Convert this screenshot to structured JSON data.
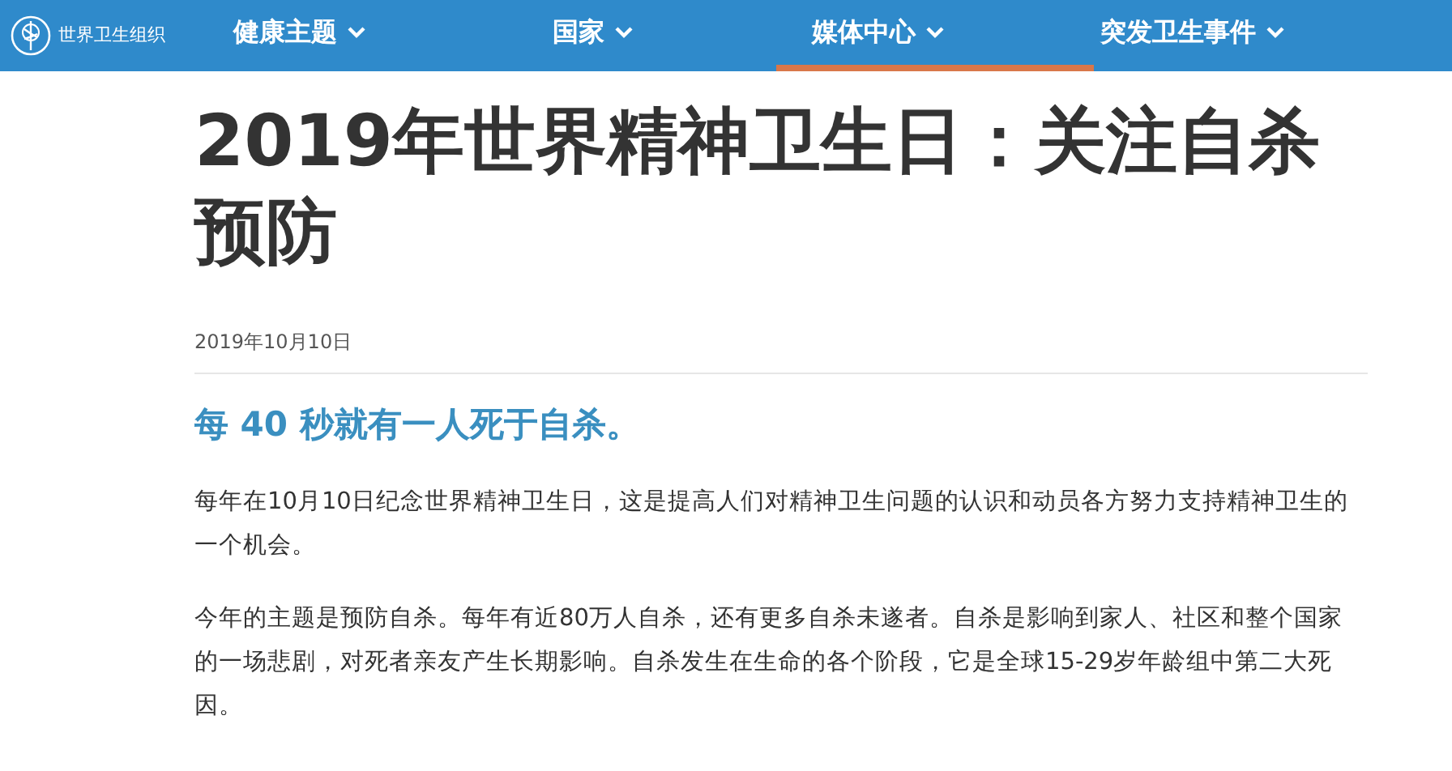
{
  "header": {
    "logo_text": "世界卫生组织",
    "nav": [
      {
        "label": "健康主题",
        "selected": false
      },
      {
        "label": "国家",
        "selected": false
      },
      {
        "label": "媒体中心",
        "selected": true
      },
      {
        "label": "突发卫生事件",
        "selected": false
      }
    ]
  },
  "article": {
    "title": "2019年世界精神卫生日：关注自杀预防",
    "date": "2019年10月10日",
    "subtitle": "每 40 秒就有一人死于自杀。",
    "paragraphs": [
      "每年在10月10日纪念世界精神卫生日，这是提高人们对精神卫生问题的认识和动员各方努力支持精神卫生的一个机会。",
      "今年的主题是预防自杀。每年有近80万人自杀，还有更多自杀未遂者。自杀是影响到家人、社区和整个国家的一场悲剧，对死者亲友产生长期影响。自杀发生在生命的各个阶段，它是全球15-29岁年龄组中第二大死因。"
    ]
  }
}
